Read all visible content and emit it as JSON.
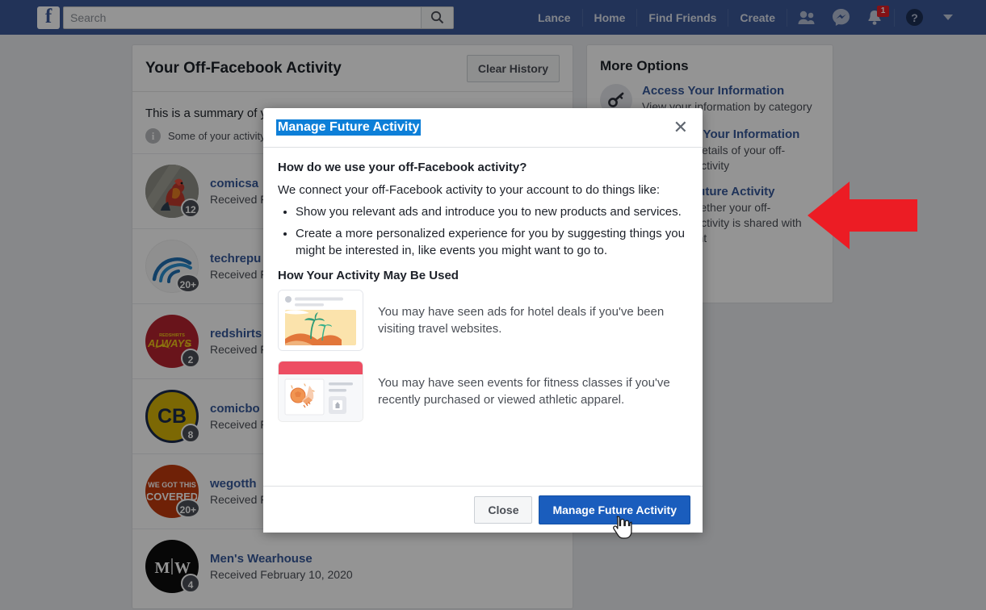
{
  "topbar": {
    "logo": "f",
    "search": {
      "placeholder": "Search",
      "value": ""
    },
    "search_icon": "search-icon",
    "nav_links": [
      "Lance",
      "Home",
      "Find Friends",
      "Create"
    ],
    "icons": [
      "friends-icon",
      "messenger-icon",
      "notifications-icon",
      "help-icon",
      "account-dropdown-icon"
    ],
    "notification_badge": "1"
  },
  "left_card": {
    "title": "Your Off-Facebook Activity",
    "clear_history_label": "Clear History",
    "summary_text": "This is a summary of your off-Facebook activity.",
    "note_text": "Some of your activity",
    "activities": [
      {
        "name": "comicsa",
        "date": "Received F",
        "count": "12",
        "avatar_kind": "photo-rooster"
      },
      {
        "name": "techrepu",
        "date": "Received F",
        "count": "20+",
        "avatar_kind": "logo-waves"
      },
      {
        "name": "redshirts",
        "date": "Received F",
        "count": "2",
        "avatar_kind": "logo-always"
      },
      {
        "name": "comicbo",
        "date": "Received F",
        "count": "8",
        "avatar_kind": "logo-cb"
      },
      {
        "name": "wegotth",
        "date": "Received F",
        "count": "20+",
        "avatar_kind": "logo-wegot"
      },
      {
        "name": "Men's Wearhouse",
        "date": "Received February 10, 2020",
        "count": "4",
        "avatar_kind": "logo-mw"
      }
    ]
  },
  "right_card": {
    "title": "More Options",
    "options": [
      {
        "link": "Access Your Information",
        "desc": "View your information by category",
        "icon": "key-icon"
      },
      {
        "link": "Download Your Information",
        "desc": "Download details of your off-Facebook activity",
        "icon": "download-icon"
      },
      {
        "link": "Manage Future Activity",
        "desc": "Manage whether your off-Facebook activity is shared with your account",
        "icon": "settings-icon"
      }
    ]
  },
  "modal": {
    "title": "Manage Future Activity",
    "close_icon": "close-icon",
    "question_heading": "How do we use your off-Facebook activity?",
    "intro": "We connect your off-Facebook activity to your account to do things like:",
    "bullets": [
      "Show you relevant ads and introduce you to new products and services.",
      "Create a more personalized experience for you by suggesting things you might be interested in, like events you might want to go to."
    ],
    "section_heading": "How Your Activity May Be Used",
    "examples": [
      {
        "text": "You may have seen ads for hotel deals if you've been visiting travel websites.",
        "thumb": "travel-beach-thumbnail"
      },
      {
        "text": "You may have seen events for fitness classes if you've recently purchased or viewed athletic apparel.",
        "thumb": "fitness-soccer-thumbnail"
      }
    ],
    "close_button": "Close",
    "primary_button": "Manage Future Activity"
  },
  "annotations": {
    "arrow": {
      "name": "red-pointer-arrow",
      "color": "#ec1c24",
      "direction": "left"
    },
    "cursor": {
      "name": "hand-cursor"
    }
  },
  "colors": {
    "brand_blue": "#3b5998",
    "link_blue": "#365899",
    "primary_button": "#1a5dbd",
    "selection_blue": "#0d7fd8",
    "accent_red": "#ec1c24"
  }
}
